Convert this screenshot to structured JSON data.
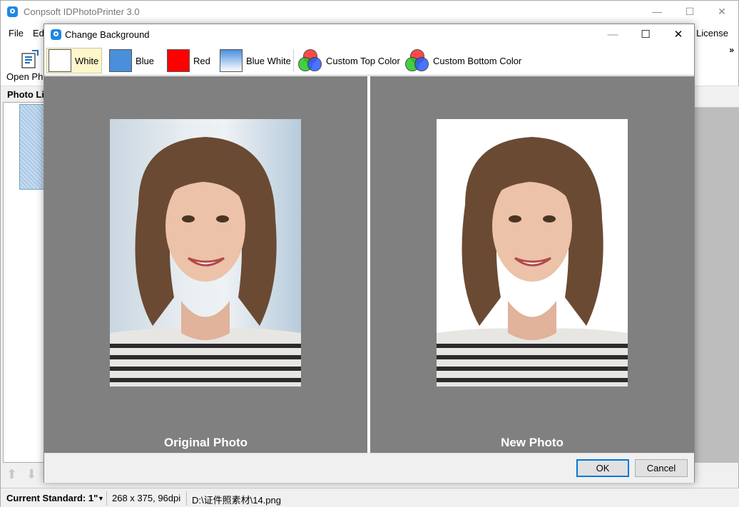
{
  "main": {
    "title": "Conpsoft IDPhotoPrinter 3.0",
    "menu": [
      "File",
      "Ed",
      "er License"
    ],
    "toolbar": {
      "open_photo": "Open Pho",
      "overflow": "»"
    },
    "photo_list_header": "Photo Li",
    "status": {
      "standard": "Current Standard: 1\"",
      "size": "268 x 375, 96dpi",
      "path": "D:\\证件照素材\\14.png"
    }
  },
  "dialog": {
    "title": "Change Background",
    "backgrounds": [
      {
        "label": "White",
        "color": "#ffffff",
        "selected": true
      },
      {
        "label": "Blue",
        "color": "#4a8fdc"
      },
      {
        "label": "Red",
        "color": "#ff0000"
      },
      {
        "label": "Blue White",
        "color": "gradient"
      },
      {
        "label": "Custom Top Color",
        "icon": "rgb-circles-icon"
      },
      {
        "label": "Custom Bottom Color",
        "icon": "rgb-circles-icon"
      }
    ],
    "original_caption": "Original Photo",
    "new_caption": "New Photo",
    "ok": "OK",
    "cancel": "Cancel"
  }
}
